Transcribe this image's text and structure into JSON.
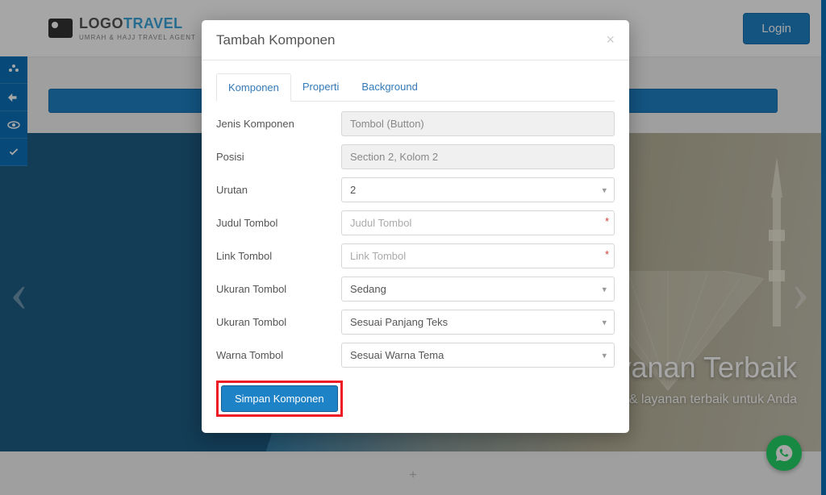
{
  "header": {
    "logo_main_a": "LOGO",
    "logo_main_b": "TRAVEL",
    "logo_sub": "UMRAH & HAJJ TRAVEL AGENT",
    "login_label": "Login"
  },
  "hero": {
    "title_frag": "Layanan Terbaik",
    "subtitle": "Garansi harga & layanan terbaik untuk Anda"
  },
  "modal": {
    "title": "Tambah Komponen",
    "tabs": {
      "komponen": "Komponen",
      "properti": "Properti",
      "background": "Background"
    },
    "labels": {
      "jenis": "Jenis Komponen",
      "posisi": "Posisi",
      "urutan": "Urutan",
      "judul": "Judul Tombol",
      "link": "Link Tombol",
      "ukuran1": "Ukuran Tombol",
      "ukuran2": "Ukuran Tombol",
      "warna": "Warna Tombol"
    },
    "values": {
      "jenis": "Tombol (Button)",
      "posisi": "Section 2, Kolom 2",
      "urutan": "2",
      "ukuran1": "Sedang",
      "ukuran2": "Sesuai Panjang Teks",
      "warna": "Sesuai Warna Tema"
    },
    "placeholders": {
      "judul": "Judul Tombol",
      "link": "Link Tombol"
    },
    "submit": "Simpan Komponen"
  }
}
